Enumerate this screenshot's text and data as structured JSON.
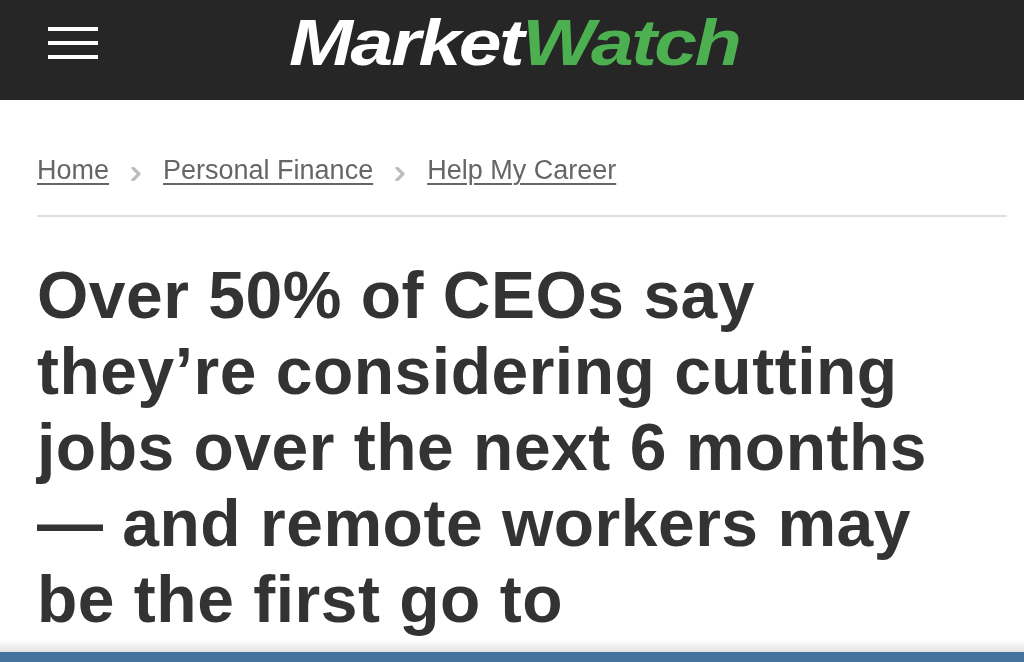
{
  "header": {
    "logo": {
      "part_1": "Market",
      "part_2": "Watch"
    }
  },
  "breadcrumbs": [
    {
      "label": "Home"
    },
    {
      "label": "Personal Finance"
    },
    {
      "label": "Help My Career"
    }
  ],
  "headline": "Over 50% of CEOs say they’re considering cutting jobs over the next 6 months — and remote workers may be the first go to"
}
